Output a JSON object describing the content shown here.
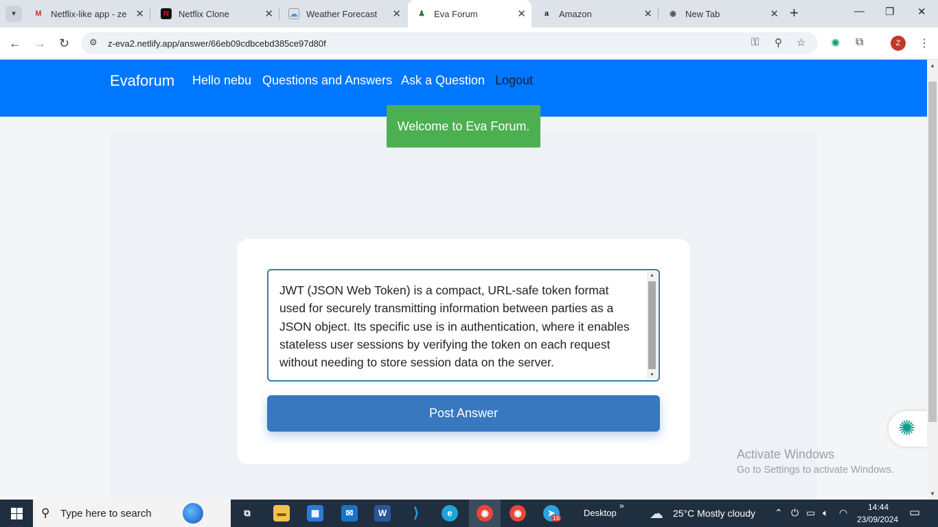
{
  "browser": {
    "tabs": [
      {
        "title": "Netflix-like app - zew",
        "icon": "gmail-icon",
        "color": "#d93025"
      },
      {
        "title": "Netflix Clone",
        "icon": "netflix-icon",
        "color": "#e50914"
      },
      {
        "title": "Weather Forecast",
        "icon": "weather-icon",
        "color": "#4a90d9"
      },
      {
        "title": "Eva Forum",
        "icon": "forum-icon",
        "color": "#2e7d32",
        "active": true
      },
      {
        "title": "Amazon",
        "icon": "amazon-icon",
        "color": "#111111"
      },
      {
        "title": "New Tab",
        "icon": "chrome-icon",
        "color": "#555555"
      }
    ],
    "url": "z-eva2.netlify.app/answer/66eb09cdbcebd385ce97d80f",
    "profile_initial": "Z"
  },
  "site": {
    "brand": "Evaforum",
    "nav": {
      "greeting": "Hello nebu",
      "qa": "Questions and Answers",
      "ask": "Ask a Question",
      "logout": "Logout"
    },
    "toast": "Welcome to Eva Forum.",
    "answer_text": "JWT (JSON Web Token) is a compact, URL-safe token format used for securely transmitting information between parties as a JSON object. Its specific use is in authentication, where it enables stateless user sessions by verifying the token on each request without needing to store session data on the server.",
    "post_button": "Post Answer",
    "colors": {
      "nav": "#0077ff",
      "toast": "#4caf50",
      "button": "#3778bf"
    }
  },
  "watermark": {
    "line1": "Activate Windows",
    "line2": "Go to Settings to activate Windows."
  },
  "taskbar": {
    "search_placeholder": "Type here to search",
    "desktop_label": "Desktop",
    "weather": "25°C  Mostly cloudy",
    "time": "14:44",
    "date": "23/09/2024",
    "telegram_badge": "16"
  }
}
